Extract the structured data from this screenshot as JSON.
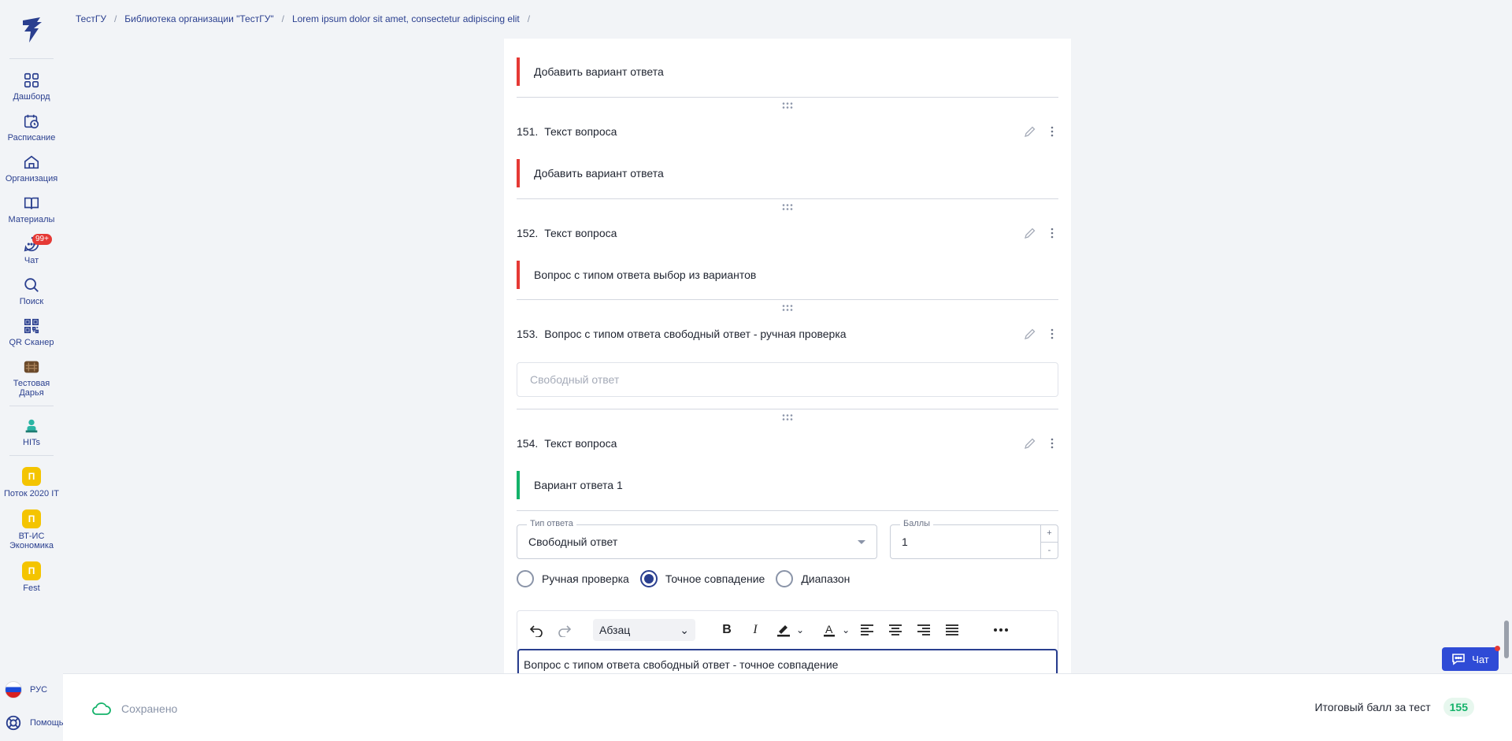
{
  "breadcrumb": {
    "items": [
      "ТестГУ",
      "Библиотека организации \"ТестГУ\"",
      "Lorem ipsum dolor sit amet, consectetur adipiscing elit"
    ]
  },
  "sidebar": {
    "items": [
      {
        "label": "Дашборд",
        "icon": "grid-icon"
      },
      {
        "label": "Расписание",
        "icon": "calendar-clock-icon"
      },
      {
        "label": "Организация",
        "icon": "home-icon"
      },
      {
        "label": "Материалы",
        "icon": "book-icon"
      },
      {
        "label": "Чат",
        "icon": "chat-icon",
        "badge": "99+"
      },
      {
        "label": "Поиск",
        "icon": "search-icon"
      },
      {
        "label": "QR Сканер",
        "icon": "qr-icon"
      },
      {
        "label": "Тестовая Дарья",
        "icon": "user-avatar"
      },
      {
        "label": "HITs",
        "icon": "hits-avatar"
      },
      {
        "label": "Поток 2020 IT",
        "avatar_letter": "П"
      },
      {
        "label": "ВТ-ИС Экономика",
        "avatar_letter": "П"
      },
      {
        "label": "Fest",
        "avatar_letter": "П"
      }
    ],
    "lang": "РУС",
    "help": "Помощь"
  },
  "questions": {
    "top_answer": "Добавить вариант ответа",
    "q151": {
      "num": "151.",
      "text": "Текст вопроса",
      "answer": "Добавить вариант ответа"
    },
    "q152": {
      "num": "152.",
      "text": "Текст вопроса",
      "answer": "Вопрос с типом ответа выбор из вариантов"
    },
    "q153": {
      "num": "153.",
      "text": "Вопрос с типом ответа свободный ответ - ручная проверка",
      "placeholder": "Свободный ответ"
    },
    "q154": {
      "num": "154.",
      "text": "Текст вопроса",
      "answer": "Вариант ответа 1"
    }
  },
  "form": {
    "answer_type_label": "Тип ответа",
    "answer_type_value": "Свободный ответ",
    "points_label": "Баллы",
    "points_value": "1",
    "plus": "+",
    "minus": "-",
    "radios": [
      "Ручная проверка",
      "Точное совпадение",
      "Диапазон"
    ],
    "selected_radio": "Точное совпадение"
  },
  "editor": {
    "paragraph_select": "Абзац",
    "content": "Вопрос с типом ответа свободный ответ - точное совпадение"
  },
  "footer": {
    "saved": "Сохранено",
    "total_label": "Итоговый балл за тест",
    "total_value": "155"
  },
  "chat_button": "Чат",
  "colors": {
    "accent": "#2a3f8f",
    "error": "#e53935",
    "success": "#14b26a",
    "chat": "#2f4bd6"
  }
}
